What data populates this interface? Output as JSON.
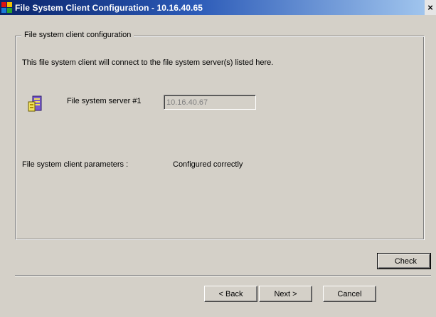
{
  "window": {
    "title": "File System Client Configuration - 10.16.40.65",
    "close_glyph": "×"
  },
  "group": {
    "legend": "File system client configuration",
    "description": "This file system client will connect to the file system server(s) listed here."
  },
  "server": {
    "label": "File system server #1",
    "value": "10.16.40.67",
    "icon": "server-icon"
  },
  "params": {
    "label": "File system client parameters :",
    "value": "Configured correctly"
  },
  "buttons": {
    "check": "Check",
    "back": "< Back",
    "next": "Next >",
    "cancel": "Cancel"
  }
}
